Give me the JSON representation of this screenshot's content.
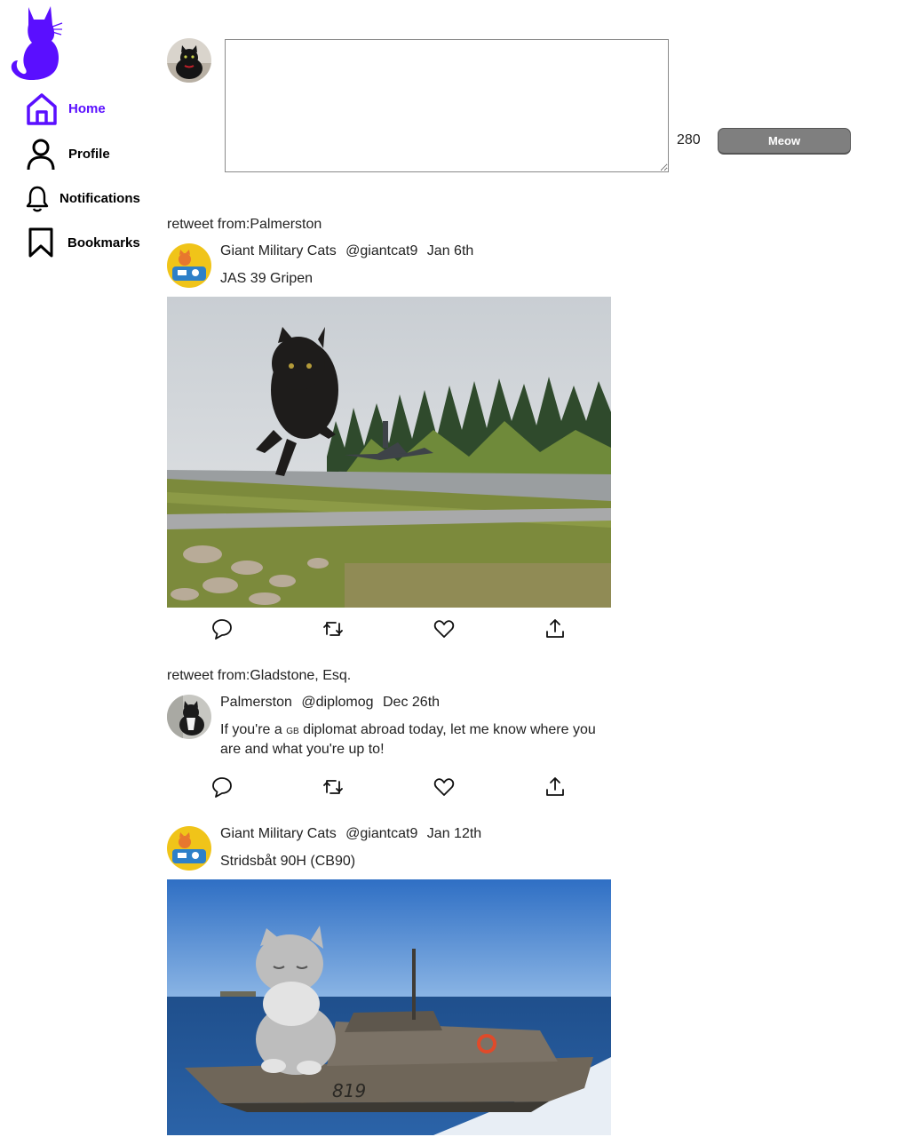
{
  "brand": {
    "accent": "#5a0fff",
    "logo_icon": "cat-silhouette-icon"
  },
  "sidebar": {
    "items": [
      {
        "label": "Home",
        "icon": "home-icon",
        "active": true
      },
      {
        "label": "Profile",
        "icon": "person-icon",
        "active": false
      },
      {
        "label": "Notifications",
        "icon": "bell-icon",
        "active": false
      },
      {
        "label": "Bookmarks",
        "icon": "bookmark-icon",
        "active": false
      }
    ]
  },
  "composer": {
    "value": "",
    "char_count": "280",
    "button_label": "Meow"
  },
  "feed": [
    {
      "retweet_label": "retweet from:Palmerston",
      "name": "Giant Military Cats",
      "handle": "@giantcat9",
      "date": "Jan 6th",
      "text": "JAS 39 Gripen",
      "image": "cat-and-jet-on-runway-photo"
    },
    {
      "retweet_label": "retweet from:Gladstone, Esq.",
      "name": "Palmerston",
      "handle": "@diplomog",
      "date": "Dec 26th",
      "text_before": "If you're a ",
      "text_smallcaps": "GB",
      "text_after": " diplomat abroad today, let me know where you are and what you're up to!"
    },
    {
      "name": "Giant Military Cats",
      "handle": "@giantcat9",
      "date": "Jan 12th",
      "text": "Stridsbåt 90H (CB90)",
      "image": "cat-on-combat-boat-photo"
    }
  ],
  "actions": [
    "reply-icon",
    "retweet-icon",
    "like-icon",
    "share-icon"
  ]
}
